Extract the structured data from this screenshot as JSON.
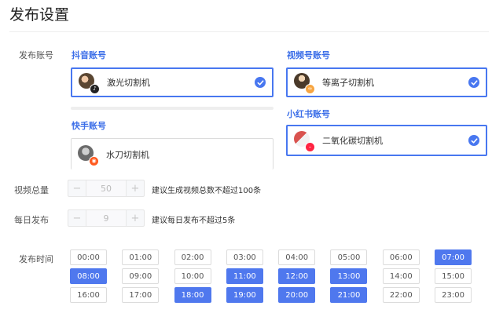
{
  "page": {
    "title": "发布设置"
  },
  "accounts": {
    "label": "发布账号",
    "douyin": {
      "title": "抖音账号",
      "items": [
        {
          "name": "激光切割机",
          "selected": true,
          "badge_icon": "tiktok-icon",
          "badge_color": "#222222"
        }
      ]
    },
    "kuaishou": {
      "title": "快手账号",
      "items": [
        {
          "name": "水刀切割机",
          "selected": false,
          "badge_icon": "kuaishou-icon",
          "badge_color": "#ff5a1f"
        }
      ]
    },
    "shipinhao": {
      "title": "视频号账号",
      "items": [
        {
          "name": "等离子切割机",
          "selected": true,
          "badge_icon": "channels-icon",
          "badge_color": "#f7a541"
        }
      ]
    },
    "xiaohongshu": {
      "title": "小红书账号",
      "items": [
        {
          "name": "二氧化碳切割机",
          "selected": true,
          "badge_icon": "xiaohongshu-icon",
          "badge_color": "#ff2442"
        }
      ]
    }
  },
  "video_total": {
    "label": "视频总量",
    "value": "50",
    "decrement": "−",
    "increment": "+",
    "hint": "建议生成视频总数不超过100条"
  },
  "daily_publish": {
    "label": "每日发布",
    "value": "9",
    "decrement": "−",
    "increment": "+",
    "hint": "建议每日发布不超过5条"
  },
  "publish_time": {
    "label": "发布时间",
    "slots": [
      {
        "time": "00:00",
        "selected": false
      },
      {
        "time": "01:00",
        "selected": false
      },
      {
        "time": "02:00",
        "selected": false
      },
      {
        "time": "03:00",
        "selected": false
      },
      {
        "time": "04:00",
        "selected": false
      },
      {
        "time": "05:00",
        "selected": false
      },
      {
        "time": "06:00",
        "selected": false
      },
      {
        "time": "07:00",
        "selected": true
      },
      {
        "time": "08:00",
        "selected": true
      },
      {
        "time": "09:00",
        "selected": false
      },
      {
        "time": "10:00",
        "selected": false
      },
      {
        "time": "11:00",
        "selected": true
      },
      {
        "time": "12:00",
        "selected": true
      },
      {
        "time": "13:00",
        "selected": true
      },
      {
        "time": "14:00",
        "selected": false
      },
      {
        "time": "15:00",
        "selected": false
      },
      {
        "time": "16:00",
        "selected": false
      },
      {
        "time": "17:00",
        "selected": false
      },
      {
        "time": "18:00",
        "selected": true
      },
      {
        "time": "19:00",
        "selected": true
      },
      {
        "time": "20:00",
        "selected": true
      },
      {
        "time": "21:00",
        "selected": true
      },
      {
        "time": "22:00",
        "selected": false
      },
      {
        "time": "23:00",
        "selected": false
      }
    ]
  },
  "colors": {
    "accent": "#4877f0",
    "selected_slot": "#4f78ee",
    "platform_title": "#3b6ee8"
  }
}
